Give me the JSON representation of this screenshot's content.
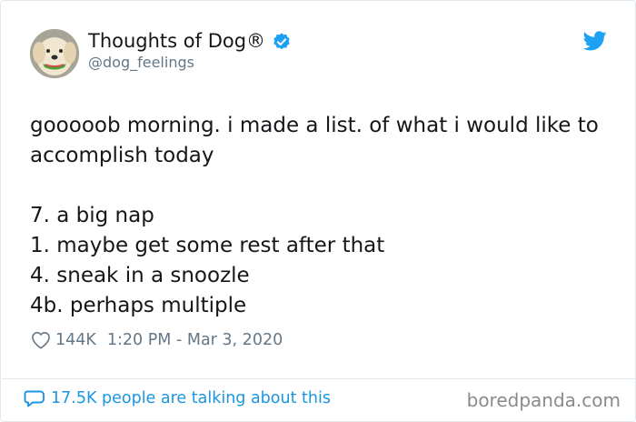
{
  "user": {
    "display_name": "Thoughts of Dog®",
    "handle": "@dog_feelings",
    "verified": true
  },
  "tweet": {
    "text": "gooooob morning. i made a list. of what i would like to accomplish today\n\n7. a big nap\n1. maybe get some rest after that\n4. sneak in a snoozle\n4b. perhaps multiple"
  },
  "meta": {
    "likes": "144K",
    "timestamp": "1:20 PM - Mar 3, 2020"
  },
  "footer": {
    "talking": "17.5K people are talking about this"
  },
  "watermark": "boredpanda.com",
  "colors": {
    "twitter_blue": "#1da1f2",
    "link_blue": "#1b95e0",
    "secondary_text": "#657786"
  }
}
